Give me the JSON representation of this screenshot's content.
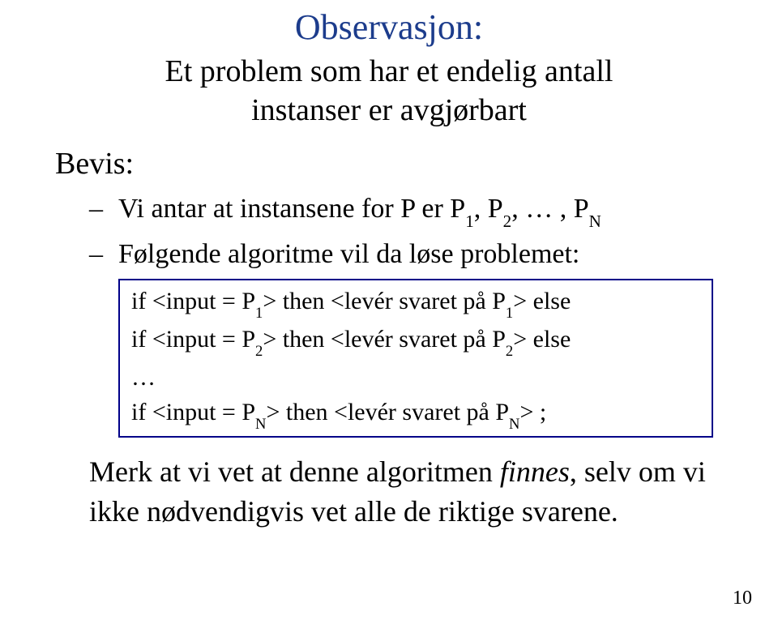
{
  "title": "Observasjon:",
  "subtitle_line1": "Et problem som har et endelig antall",
  "subtitle_line2": "instanser er avgjørbart",
  "bevis_label": "Bevis:",
  "bullet1_pre": "Vi antar at instansene for P er P",
  "bullet1_mid": ", P",
  "bullet1_post": ", … , P",
  "sub1": "1",
  "sub2": "2",
  "subN": "N",
  "bullet2": "Følgende algoritme vil da løse problemet:",
  "algo_line1_a": "if  <input = P",
  "algo_line1_b": "> then <levér svaret på P",
  "algo_line1_c": "> else",
  "algo_line2_a": "if  <input = P",
  "algo_line2_b": "> then <levér svaret på P",
  "algo_line2_c": "> else",
  "algo_dots": "…",
  "algo_line3_a": "if  <input = P",
  "algo_line3_b": "> then <levér svaret på P",
  "algo_line3_c": "> ;",
  "conclusion_a": "Merk at vi vet at denne algoritmen ",
  "conclusion_italic": "finnes",
  "conclusion_b": ", selv om vi ikke nødvendigvis vet alle de riktige svarene.",
  "pagenum": "10",
  "dash": "–"
}
